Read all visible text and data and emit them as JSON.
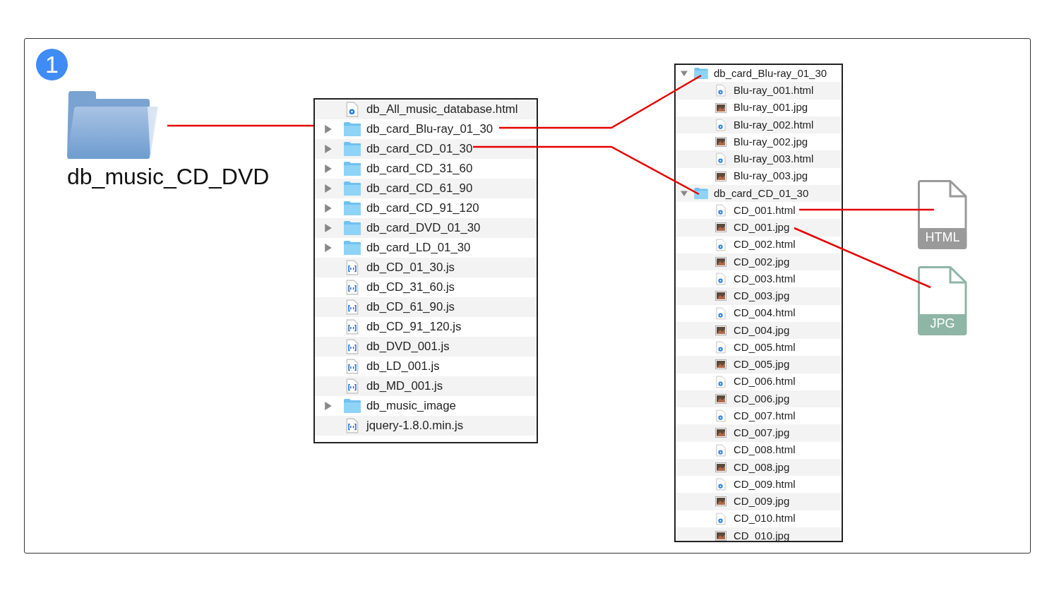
{
  "step_number": "1",
  "root_folder": {
    "name": "db_music_CD_DVD"
  },
  "folder_listing": [
    {
      "kind": "html",
      "name": "db_All_music_database.html"
    },
    {
      "kind": "folder",
      "name": "db_card_Blu-ray_01_30",
      "expanded": false
    },
    {
      "kind": "folder",
      "name": "db_card_CD_01_30",
      "expanded": false
    },
    {
      "kind": "folder",
      "name": "db_card_CD_31_60",
      "expanded": false
    },
    {
      "kind": "folder",
      "name": "db_card_CD_61_90",
      "expanded": false
    },
    {
      "kind": "folder",
      "name": "db_card_CD_91_120",
      "expanded": false
    },
    {
      "kind": "folder",
      "name": "db_card_DVD_01_30",
      "expanded": false
    },
    {
      "kind": "folder",
      "name": "db_card_LD_01_30",
      "expanded": false
    },
    {
      "kind": "js",
      "name": "db_CD_01_30.js"
    },
    {
      "kind": "js",
      "name": "db_CD_31_60.js"
    },
    {
      "kind": "js",
      "name": "db_CD_61_90.js"
    },
    {
      "kind": "js",
      "name": "db_CD_91_120.js"
    },
    {
      "kind": "js",
      "name": "db_DVD_001.js"
    },
    {
      "kind": "js",
      "name": "db_LD_001.js"
    },
    {
      "kind": "js",
      "name": "db_MD_001.js"
    },
    {
      "kind": "folder",
      "name": "db_music_image",
      "expanded": false
    },
    {
      "kind": "js",
      "name": "jquery-1.8.0.min.js"
    }
  ],
  "expanded_listing": [
    {
      "kind": "folder",
      "name": "db_card_Blu-ray_01_30",
      "expanded": true,
      "children": [
        {
          "kind": "html",
          "name": "Blu-ray_001.html"
        },
        {
          "kind": "jpg",
          "name": "Blu-ray_001.jpg"
        },
        {
          "kind": "html",
          "name": "Blu-ray_002.html"
        },
        {
          "kind": "jpg",
          "name": "Blu-ray_002.jpg"
        },
        {
          "kind": "html",
          "name": "Blu-ray_003.html"
        },
        {
          "kind": "jpg",
          "name": "Blu-ray_003.jpg"
        }
      ]
    },
    {
      "kind": "folder",
      "name": "db_card_CD_01_30",
      "expanded": true,
      "children": [
        {
          "kind": "html",
          "name": "CD_001.html"
        },
        {
          "kind": "jpg",
          "name": "CD_001.jpg"
        },
        {
          "kind": "html",
          "name": "CD_002.html"
        },
        {
          "kind": "jpg",
          "name": "CD_002.jpg"
        },
        {
          "kind": "html",
          "name": "CD_003.html"
        },
        {
          "kind": "jpg",
          "name": "CD_003.jpg"
        },
        {
          "kind": "html",
          "name": "CD_004.html"
        },
        {
          "kind": "jpg",
          "name": "CD_004.jpg"
        },
        {
          "kind": "html",
          "name": "CD_005.html"
        },
        {
          "kind": "jpg",
          "name": "CD_005.jpg"
        },
        {
          "kind": "html",
          "name": "CD_006.html"
        },
        {
          "kind": "jpg",
          "name": "CD_006.jpg"
        },
        {
          "kind": "html",
          "name": "CD_007.html"
        },
        {
          "kind": "jpg",
          "name": "CD_007.jpg"
        },
        {
          "kind": "html",
          "name": "CD_008.html"
        },
        {
          "kind": "jpg",
          "name": "CD_008.jpg"
        },
        {
          "kind": "html",
          "name": "CD_009.html"
        },
        {
          "kind": "jpg",
          "name": "CD_009.jpg"
        },
        {
          "kind": "html",
          "name": "CD_010.html"
        },
        {
          "kind": "jpg",
          "name": "CD_010.jpg"
        }
      ]
    }
  ],
  "file_types": [
    {
      "label": "HTML",
      "color": "#9a9a9a"
    },
    {
      "label": "JPG",
      "color": "#8fb5a6"
    }
  ]
}
